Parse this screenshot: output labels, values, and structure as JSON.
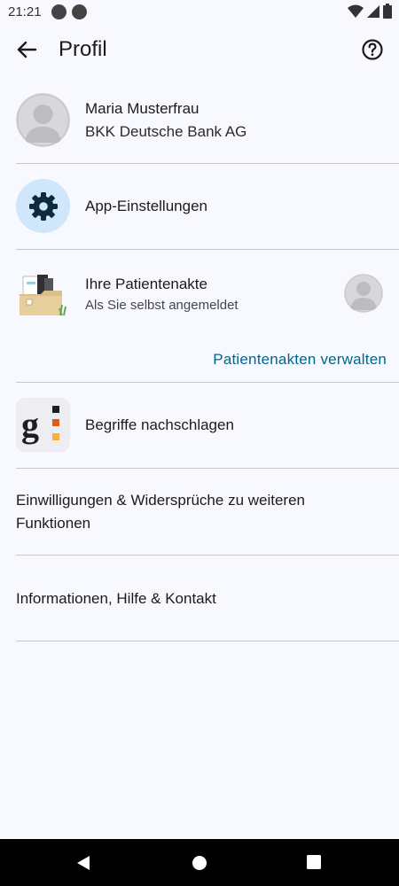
{
  "status": {
    "time": "21:21"
  },
  "appbar": {
    "title": "Profil"
  },
  "profile": {
    "name": "Maria Musterfrau",
    "insurance": "BKK Deutsche Bank AG"
  },
  "settings": {
    "label": "App-Einstellungen"
  },
  "record": {
    "title": "Ihre Patientenakte",
    "subtitle": "Als Sie selbst angemeldet",
    "manage_link": "Patientenakten verwalten"
  },
  "lexicon": {
    "label": "Begriffe nachschlagen"
  },
  "consents": {
    "label": "Einwilligungen & Widersprüche zu weiteren Funktionen"
  },
  "info": {
    "label": "Informationen, Hilfe & Kontakt"
  },
  "icons": [
    "back-arrow-icon",
    "help-icon",
    "gear-icon",
    "folder-icon",
    "avatar-icon",
    "lexicon-icon",
    "wifi-icon",
    "signal-icon",
    "battery-icon",
    "nav-back-icon",
    "nav-home-icon",
    "nav-recents-icon"
  ],
  "colors": {
    "background": "#f8f9fe",
    "link": "#00658f",
    "gear_bg": "#cfe6fb",
    "divider": "#c8c8cc"
  }
}
